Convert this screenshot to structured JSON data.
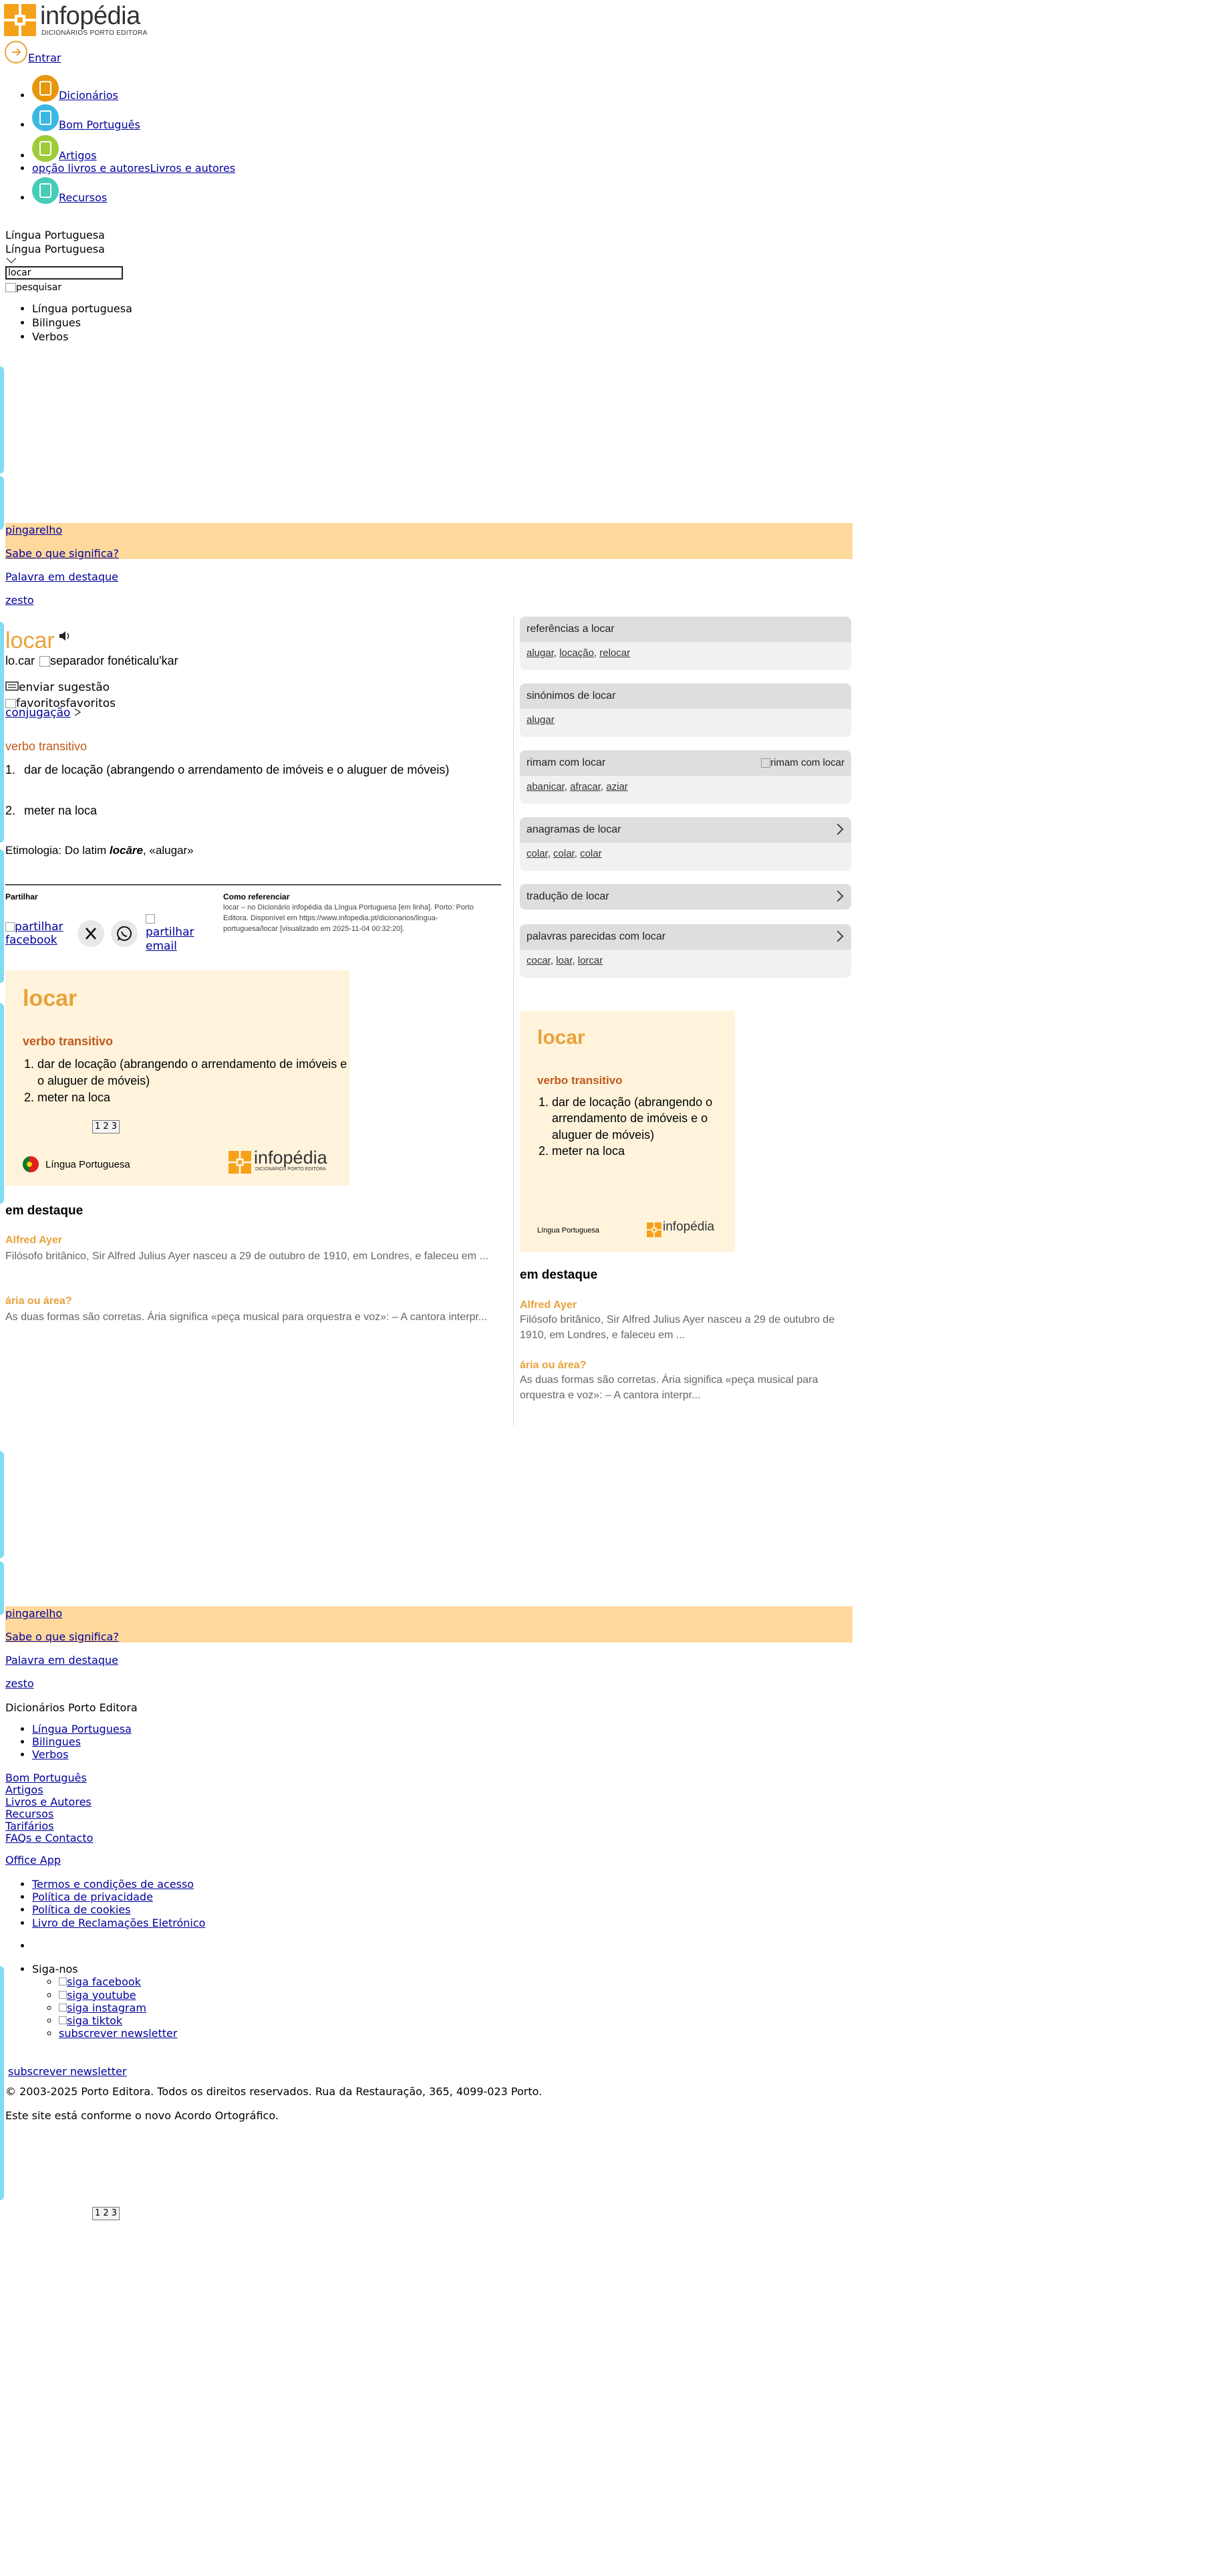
{
  "header": {
    "brand_name": "infopédia",
    "brand_sub": "DICIONÁRIOS PORTO EDITORA",
    "login_label": "Entrar"
  },
  "nav": {
    "items": [
      {
        "label": "Dicionários",
        "color": "#e8960c"
      },
      {
        "label": "Bom Português",
        "color": "#3cb7e2"
      },
      {
        "label": "Artigos",
        "color": "#9fcb3a"
      },
      {
        "label": "Livros e autores",
        "img_alt": "opção livros e autores"
      },
      {
        "label": "Recursos",
        "color": "#45cdb8"
      }
    ]
  },
  "search": {
    "dictionary_selected": "Língua Portuguesa",
    "dictionary_display": "Língua Portuguesa",
    "query_value": "locar",
    "submit_alt": "pesquisar",
    "options": [
      "Língua portuguesa",
      "Bilingues",
      "Verbos"
    ]
  },
  "highlight_banner": {
    "word": "pingarelho",
    "question": "Sabe o que significa?",
    "featured_label": "Palavra em destaque",
    "featured_word": "zesto"
  },
  "entry": {
    "headword": "locar",
    "syllables": "lo.car",
    "separator_alt": "separador fonética",
    "phonetic": "lu'kar",
    "suggest_label": "enviar sugestão",
    "favorites_alt": "favoritos",
    "favorites_label": "favoritos",
    "conjugation_label": "conjugação",
    "pos": "verbo transitivo",
    "senses": [
      "dar de locação (abrangendo o arrendamento de imóveis e o aluguer de móveis)",
      "meter na loca"
    ],
    "etymology_prefix": "Etimologia: Do latim ",
    "etymology_word": "locāre",
    "etymology_suffix": ", «alugar»"
  },
  "share": {
    "title": "Partilhar",
    "facebook_alt": "partilhar facebook",
    "email_alt": "partilhar email"
  },
  "cite": {
    "title": "Como referenciar",
    "text": "locar – no Dicionário infopédia da Língua Portuguesa [em linha]. Porto: Porto Editora. Disponível em https://www.infopedia.pt/dicionarios/lingua-portuguesa/locar [visualizado em 2025-11-04 00:32:20]."
  },
  "card_main": {
    "headword": "locar",
    "pos": "verbo transitivo",
    "senses": [
      "dar de locação (abrangendo o arrendamento de imóveis e o aluguer de móveis)",
      "meter na loca"
    ],
    "pager": "1 2 3",
    "dictionary": "Língua Portuguesa",
    "brand_name": "infopédia",
    "brand_sub": "DICIONÁRIOS PORTO EDITORA"
  },
  "card_side": {
    "headword": "locar",
    "pos": "verbo transitivo",
    "senses": [
      "dar de locação (abrangendo o arrendamento de imóveis e o aluguer de móveis)",
      "meter na loca"
    ],
    "dictionary": "Língua Portuguesa",
    "brand_name": "infopédia"
  },
  "featured": {
    "title": "em destaque",
    "items": [
      {
        "title": "Alfred Ayer",
        "text": "Filósofo britânico, Sir Alfred Julius Ayer nasceu a 29 de outubro de 1910, em Londres, e faleceu em ..."
      },
      {
        "title": "ária ou área?",
        "text": "As duas formas são corretas. Ária significa «peça musical para orquestra e voz»: – A cantora interpr..."
      }
    ]
  },
  "sidebar_refs": [
    {
      "title": "referências a locar",
      "links": [
        "alugar",
        "locação",
        "relocar"
      ],
      "chevron": false
    },
    {
      "title": "sinónimos de locar",
      "links": [
        "alugar"
      ],
      "chevron": false
    },
    {
      "title": "rimam com locar",
      "links": [
        "abanicar",
        "afracar",
        "aziar"
      ],
      "chevron": false,
      "img_alt": "rimam com locar"
    },
    {
      "title": "anagramas de locar",
      "links": [
        "colar",
        "colar",
        "colar"
      ],
      "chevron": true
    },
    {
      "title": "tradução de locar",
      "links": [],
      "chevron": true
    },
    {
      "title": "palavras parecidas com locar",
      "links": [
        "cocar",
        "loar",
        "lorcar"
      ],
      "chevron": true
    }
  ],
  "footer": {
    "section_title": "Dicionários Porto Editora",
    "dict_links": [
      "Língua Portuguesa",
      "Bilingues",
      "Verbos"
    ],
    "links": [
      "Bom Português",
      "Artigos",
      "Livros e Autores",
      "Recursos",
      "Tarifários",
      "FAQs e Contacto"
    ],
    "office_app": "Office App",
    "legal": [
      "Termos e condições de acesso",
      "Política de privacidade",
      "Política de cookies",
      "Livro de Reclamações Eletrónico"
    ],
    "follow_label": "Siga-nos",
    "social": [
      "siga facebook",
      "siga youtube",
      "siga instagram",
      "siga tiktok"
    ],
    "newsletter": "subscrever newsletter",
    "newsletter_button": "subscrever newsletter",
    "copyright": "© 2003-2025 Porto Editora. Todos os direitos reservados. Rua da Restauração, 365, 4099-023 Porto.",
    "acordo": "Este site está conforme o novo Acordo Ortográfico.",
    "pager": "1 2 3"
  }
}
